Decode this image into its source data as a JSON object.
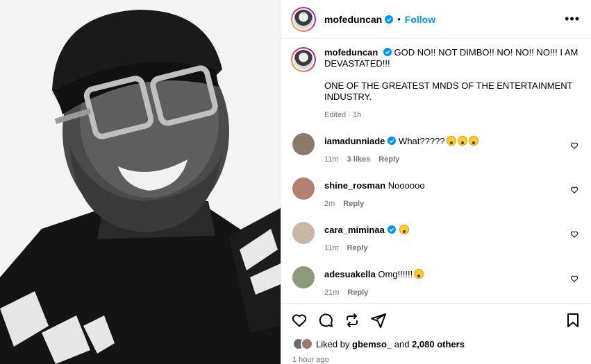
{
  "post": {
    "username": "mofeduncan",
    "follow_label": "Follow",
    "more_label": "•••",
    "bullet": "•"
  },
  "caption": {
    "username": "mofeduncan",
    "text": "GOD NO!! NOT DIMBO!! NO! NO!! NO!!! I AM DEVASTATED!!!\n\nONE OF THE GREATEST MNDS OF THE ENTERTAINMENT INDUSTRY.",
    "edited": "Edited",
    "dot": "·",
    "age": "1h"
  },
  "comments": [
    {
      "username": "iamadunniade",
      "text": "What?????",
      "emoji_count": 3,
      "age": "11m",
      "likes": "3 likes",
      "reply": "Reply",
      "verified": true,
      "avatar_color": "#8a7a6a"
    },
    {
      "username": "shine_rosman",
      "text": "Noooooo",
      "emoji_count": 0,
      "age": "2m",
      "likes": "",
      "reply": "Reply",
      "verified": false,
      "avatar_color": "#b08070"
    },
    {
      "username": "cara_miminaa",
      "text": "",
      "emoji_count": 1,
      "age": "11m",
      "likes": "",
      "reply": "Reply",
      "verified": true,
      "avatar_color": "#c8b8a8"
    },
    {
      "username": "adesuakella",
      "text": "Omg!!!!!!",
      "emoji_count": 1,
      "age": "21m",
      "likes": "",
      "reply": "Reply",
      "verified": false,
      "avatar_color": "#8a9a7a"
    }
  ],
  "likes": {
    "prefix": "Liked by",
    "user": "gbemso_",
    "and": "and",
    "others": "2,080 others"
  },
  "timestamp": "1 hour ago",
  "colors": {
    "link": "#0095f6",
    "muted": "#737373",
    "verified": "#0095f6"
  }
}
